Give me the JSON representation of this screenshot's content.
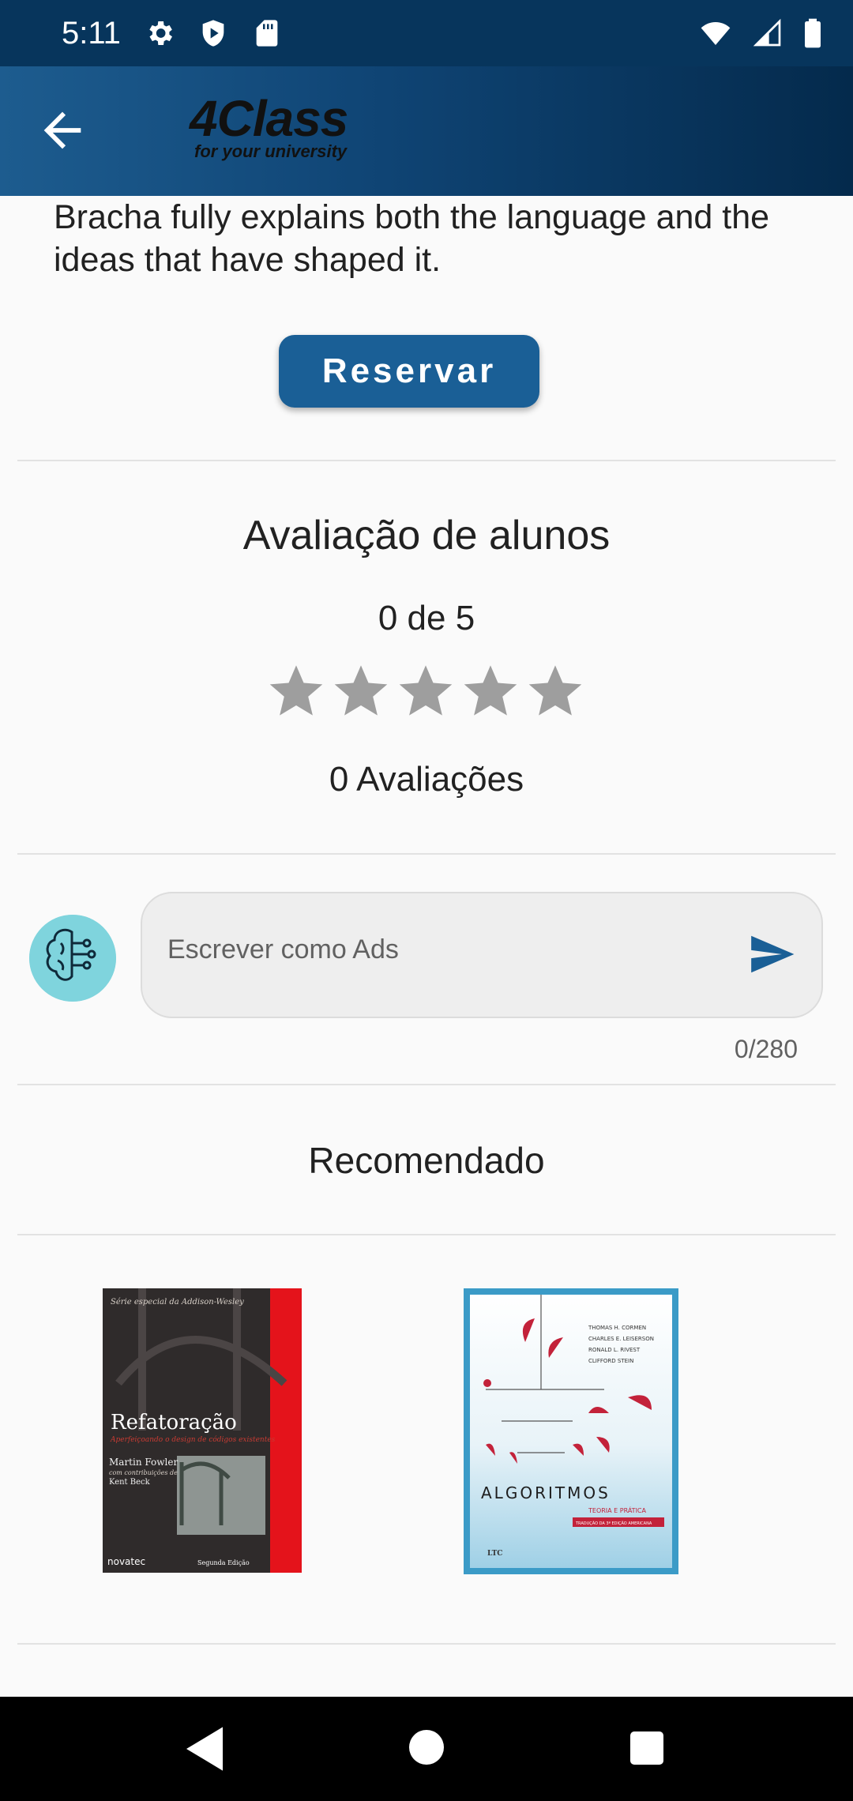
{
  "status_bar": {
    "time": "5:11",
    "left_icons": [
      "settings-icon",
      "shield-icon",
      "sd-card-icon"
    ],
    "right_icons": [
      "wifi-icon",
      "cellular-signal-icon",
      "battery-icon"
    ]
  },
  "app_bar": {
    "back_icon": "arrow-back-icon",
    "logo_main": "4Class",
    "logo_sub": "for your university"
  },
  "book_detail": {
    "description": "Bracha fully explains both the language and the ideas that have shaped it.",
    "reserve_label": "Reservar"
  },
  "rating": {
    "title": "Avaliação de alunos",
    "score_text": "0 de 5",
    "stars_filled": 0,
    "stars_total": 5,
    "reviews_count": "0 Avaliações",
    "star_color": "#9e9e9e"
  },
  "comment": {
    "avatar_icon": "brain-circuit-icon",
    "placeholder": "Escrever como Ads",
    "send_icon": "send-icon",
    "char_count": "0/280"
  },
  "recommended": {
    "title": "Recomendado",
    "books": [
      {
        "cover_series": "Série especial da Addison-Wesley",
        "title": "Refatoração",
        "subtitle": "Aperfeiçoando o design de códigos existentes",
        "author": "Martin Fowler",
        "contributors_label": "com contribuições de",
        "contributor": "Kent Beck",
        "publisher": "novatec",
        "edition": "Segunda Edição"
      },
      {
        "authors": [
          "THOMAS H. CORMEN",
          "CHARLES E. LEISERSON",
          "RONALD L. RIVEST",
          "CLIFFORD STEIN"
        ],
        "title": "ALGORITMOS",
        "subtitle": "TEORIA E PRÁTICA",
        "badge": "TRADUÇÃO DA 3ª EDIÇÃO AMERICANA",
        "publisher": "LTC"
      }
    ]
  },
  "colors": {
    "primary": "#1a5f96",
    "status_bar": "#07355c"
  }
}
